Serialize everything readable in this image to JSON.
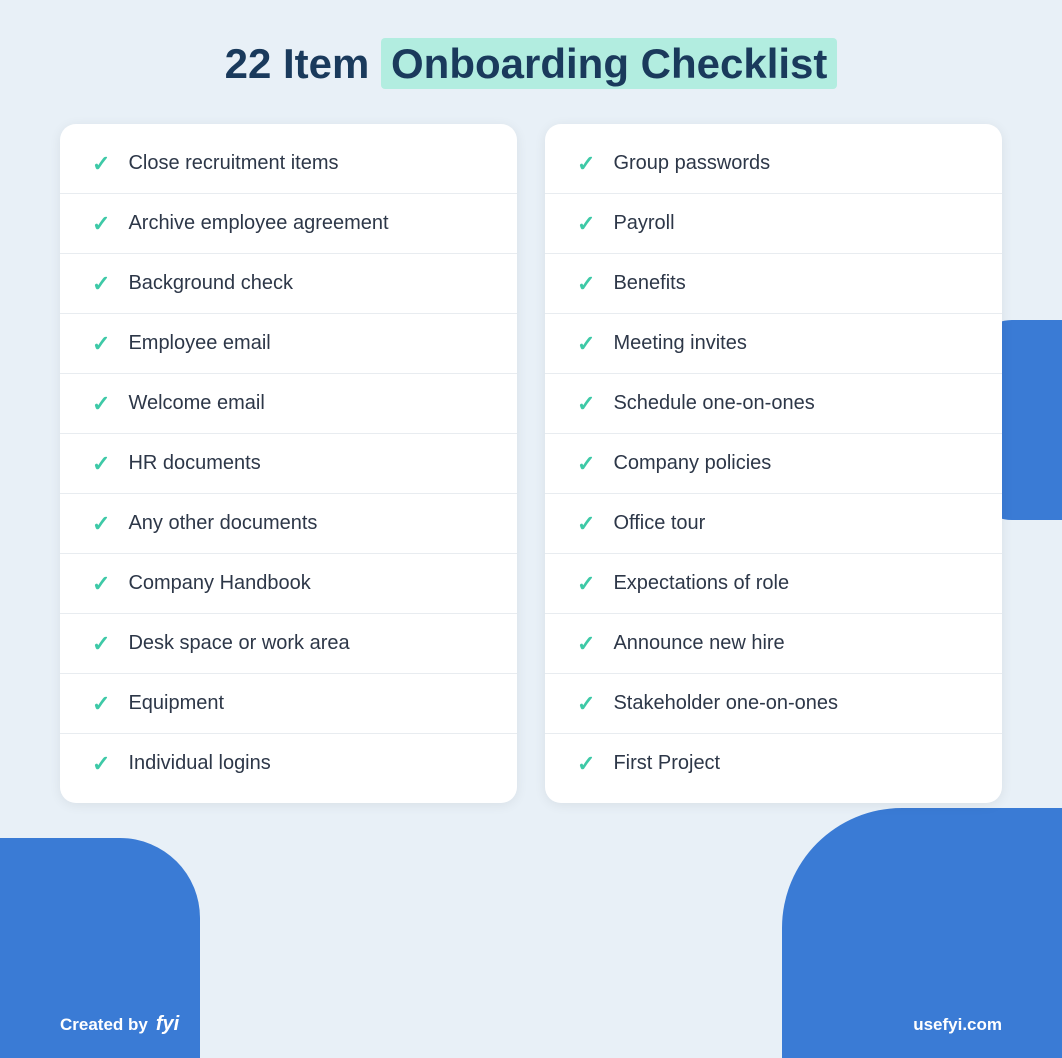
{
  "title": {
    "prefix": "22 Item ",
    "highlight": "Onboarding Checklist"
  },
  "left_column": [
    "Close recruitment items",
    "Archive employee agreement",
    "Background check",
    "Employee email",
    "Welcome email",
    "HR documents",
    "Any other documents",
    "Company Handbook",
    "Desk space or work area",
    "Equipment",
    "Individual logins"
  ],
  "right_column": [
    "Group passwords",
    "Payroll",
    "Benefits",
    "Meeting invites",
    "Schedule one-on-ones",
    "Company policies",
    "Office tour",
    "Expectations of role",
    "Announce new hire",
    "Stakeholder one-on-ones",
    "First Project"
  ],
  "footer": {
    "created_by": "Created by",
    "brand": "fyi",
    "website": "usefyi.com"
  },
  "check_symbol": "✓"
}
